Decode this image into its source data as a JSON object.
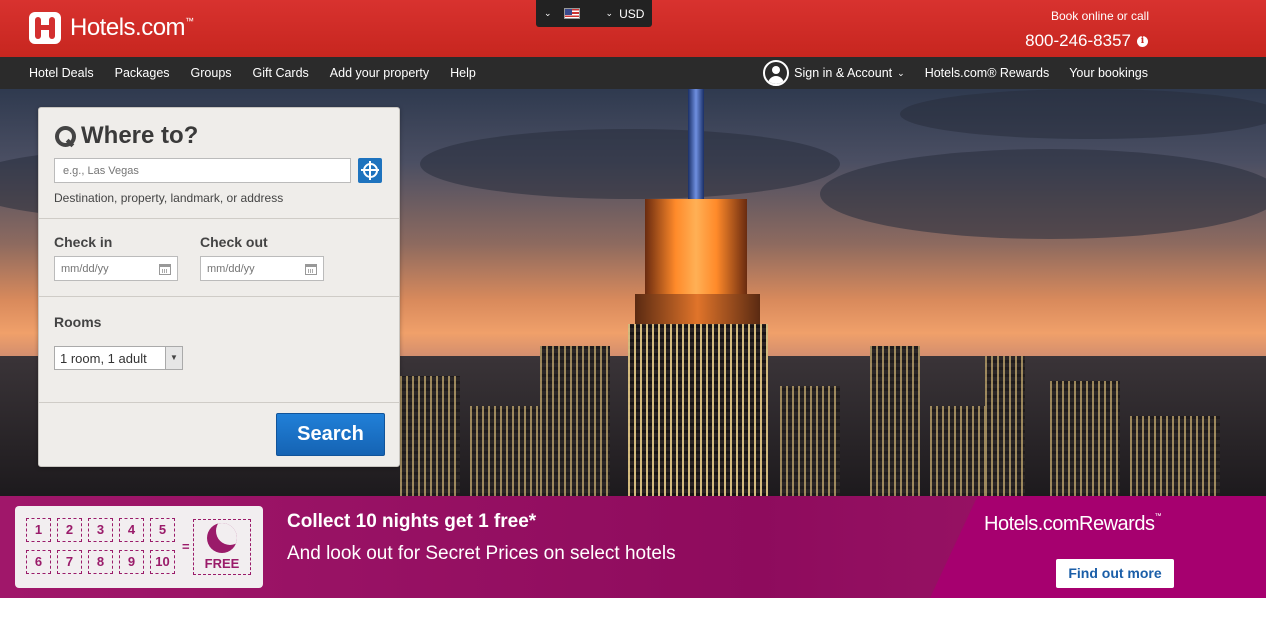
{
  "header": {
    "brand": "Hotels.com",
    "brand_tm": "™",
    "currency": {
      "flag": "us-flag-icon",
      "code": "USD"
    },
    "book_online": "Book online or call",
    "phone": "800-246-8357",
    "phone_info_glyph": "i",
    "accent_color": "#d32f2f"
  },
  "nav": {
    "items": [
      "Hotel Deals",
      "Packages",
      "Groups",
      "Gift Cards",
      "Add your property",
      "Help"
    ],
    "sign_in": "Sign in & Account",
    "rewards": "Hotels.com® Rewards",
    "bookings": "Your bookings"
  },
  "search": {
    "title": "Where to?",
    "destination_placeholder": "e.g., Las Vegas",
    "destination_help": "Destination, property, landmark, or address",
    "checkin_label": "Check in",
    "checkin_placeholder": "mm/dd/yy",
    "checkout_label": "Check out",
    "checkout_placeholder": "mm/dd/yy",
    "rooms_label": "Rooms",
    "rooms_value": "1 room, 1 adult",
    "search_button": "Search",
    "button_color": "#1a6fc4"
  },
  "rewards_banner": {
    "nights": [
      "1",
      "2",
      "3",
      "4",
      "5",
      "6",
      "7",
      "8",
      "9",
      "10"
    ],
    "equals": "=",
    "free": "FREE",
    "headline": "Collect 10 nights get 1 free*",
    "subline": "And look out for Secret Prices on select hotels",
    "logo": "Hotels.comRewards",
    "logo_tm": "™",
    "cta": "Find out more",
    "banner_color": "#9a0d63"
  }
}
